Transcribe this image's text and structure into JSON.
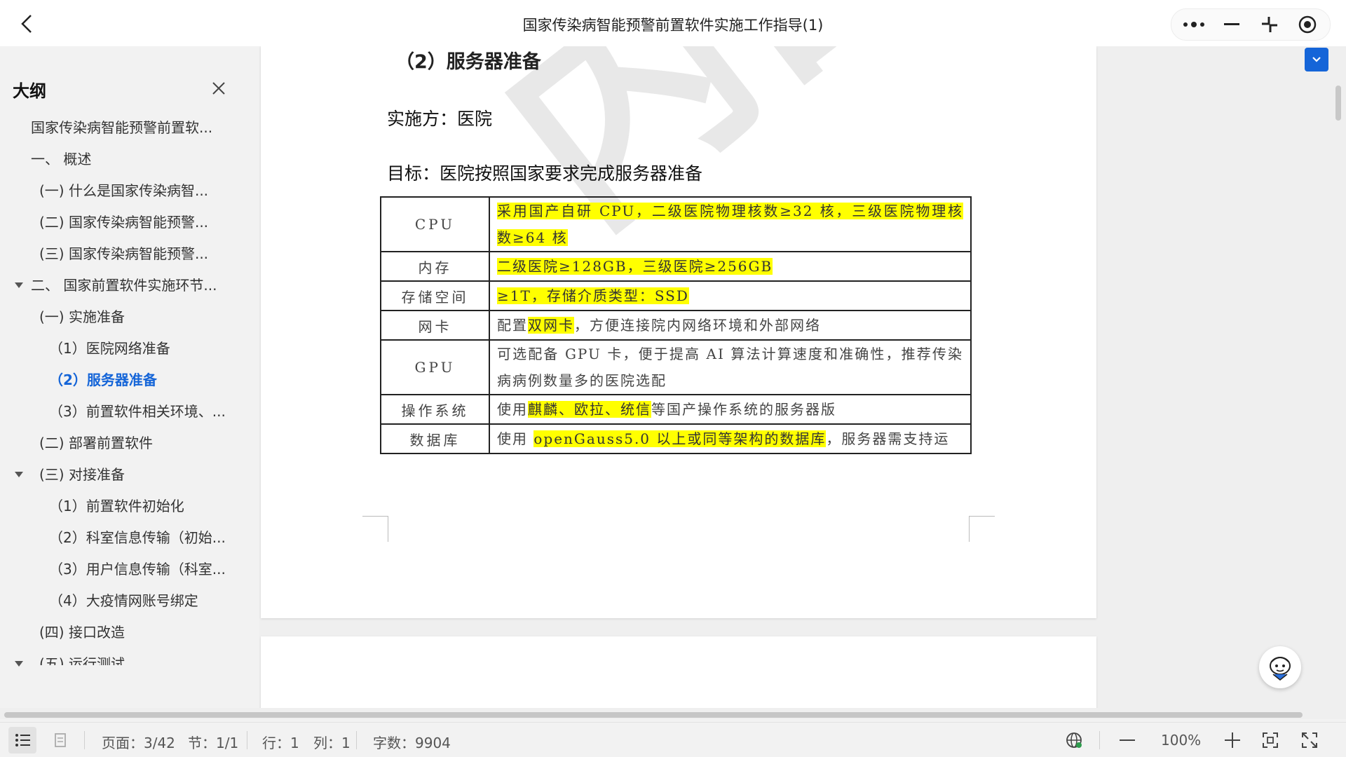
{
  "window": {
    "title": "国家传染病智能预警前置软件实施工作指导(1)"
  },
  "sidebar": {
    "title": "大纲",
    "items": [
      {
        "label": "国家传染病智能预警前置软..."
      },
      {
        "label": "一、 概述"
      },
      {
        "label": "(一) 什么是国家传染病智..."
      },
      {
        "label": "(二) 国家传染病智能预警..."
      },
      {
        "label": "(三) 国家传染病智能预警..."
      },
      {
        "label": "二、 国家前置软件实施环节..."
      },
      {
        "label": "(一)  实施准备"
      },
      {
        "label": "（1）医院网络准备"
      },
      {
        "label": "（2）服务器准备"
      },
      {
        "label": "（3）前置软件相关环境、..."
      },
      {
        "label": "(二)  部署前置软件"
      },
      {
        "label": "(三)  对接准备"
      },
      {
        "label": "（1）前置软件初始化"
      },
      {
        "label": "（2）科室信息传输（初始..."
      },
      {
        "label": "（3）用户信息传输（科室..."
      },
      {
        "label": "（4）大疫情网账号绑定"
      },
      {
        "label": "(四)  接口改造"
      },
      {
        "label": "(五)  运行测试"
      }
    ]
  },
  "document": {
    "heading": "（2）服务器准备",
    "implementer": "实施方：医院",
    "goal": "目标：医院按照国家要求完成服务器准备",
    "watermark": "内部",
    "table": {
      "rows": [
        {
          "key": "CPU",
          "segments": [
            {
              "text": "采用国产自研 CPU，二级医院物理核数≥32 核，三级医院物理核数≥64 核",
              "hl": true
            }
          ]
        },
        {
          "key": "内存",
          "segments": [
            {
              "text": "二级医院≥128GB，三级医院≥256GB",
              "hl": true
            }
          ]
        },
        {
          "key": "存储空间",
          "segments": [
            {
              "text": "≥1T，存储介质类型：SSD",
              "hl": true
            }
          ]
        },
        {
          "key": "网卡",
          "segments": [
            {
              "text": "配置",
              "hl": false
            },
            {
              "text": "双网卡",
              "hl": true
            },
            {
              "text": "，方便连接院内网络环境和外部网络",
              "hl": false
            }
          ]
        },
        {
          "key": "GPU",
          "segments": [
            {
              "text": "可选配备 GPU 卡，便于提高 AI 算法计算速度和准确性，推荐传染病病例数量多的医院选配",
              "hl": false
            }
          ]
        },
        {
          "key": "操作系统",
          "segments": [
            {
              "text": "使用",
              "hl": false
            },
            {
              "text": "麒麟、欧拉、统信",
              "hl": true
            },
            {
              "text": "等国产操作系统的服务器版",
              "hl": false
            }
          ]
        },
        {
          "key": "数据库",
          "segments": [
            {
              "text": "使用 ",
              "hl": false
            },
            {
              "text": "openGauss5.0 以上或同等架构的数据库",
              "hl": true
            },
            {
              "text": "，服务器需支持运",
              "hl": false
            }
          ]
        }
      ]
    }
  },
  "statusbar": {
    "page": "页面：3/42",
    "section": "节：1/1",
    "row": "行：1",
    "col": "列：1",
    "words": "字数：9904",
    "zoom": "100%"
  },
  "colors": {
    "accent": "#1565d8",
    "highlight": "#ffff00"
  }
}
